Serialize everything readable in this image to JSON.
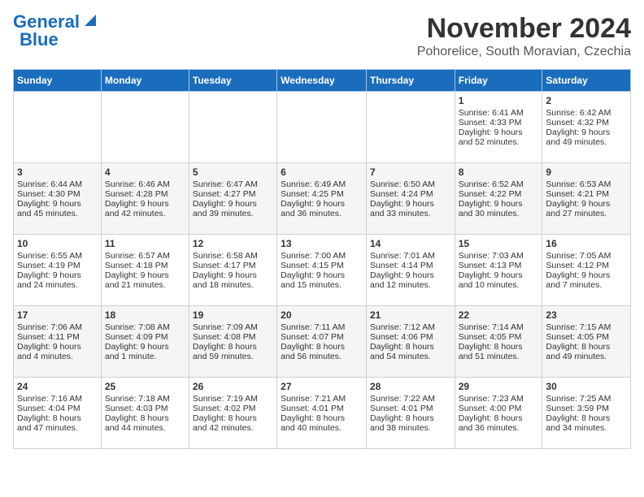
{
  "logo": {
    "line1": "General",
    "line2": "Blue"
  },
  "title": "November 2024",
  "location": "Pohorelice, South Moravian, Czechia",
  "days_header": [
    "Sunday",
    "Monday",
    "Tuesday",
    "Wednesday",
    "Thursday",
    "Friday",
    "Saturday"
  ],
  "weeks": [
    [
      {
        "day": "",
        "data": ""
      },
      {
        "day": "",
        "data": ""
      },
      {
        "day": "",
        "data": ""
      },
      {
        "day": "",
        "data": ""
      },
      {
        "day": "",
        "data": ""
      },
      {
        "day": "1",
        "data": "Sunrise: 6:41 AM\nSunset: 4:33 PM\nDaylight: 9 hours\nand 52 minutes."
      },
      {
        "day": "2",
        "data": "Sunrise: 6:42 AM\nSunset: 4:32 PM\nDaylight: 9 hours\nand 49 minutes."
      }
    ],
    [
      {
        "day": "3",
        "data": "Sunrise: 6:44 AM\nSunset: 4:30 PM\nDaylight: 9 hours\nand 45 minutes."
      },
      {
        "day": "4",
        "data": "Sunrise: 6:46 AM\nSunset: 4:28 PM\nDaylight: 9 hours\nand 42 minutes."
      },
      {
        "day": "5",
        "data": "Sunrise: 6:47 AM\nSunset: 4:27 PM\nDaylight: 9 hours\nand 39 minutes."
      },
      {
        "day": "6",
        "data": "Sunrise: 6:49 AM\nSunset: 4:25 PM\nDaylight: 9 hours\nand 36 minutes."
      },
      {
        "day": "7",
        "data": "Sunrise: 6:50 AM\nSunset: 4:24 PM\nDaylight: 9 hours\nand 33 minutes."
      },
      {
        "day": "8",
        "data": "Sunrise: 6:52 AM\nSunset: 4:22 PM\nDaylight: 9 hours\nand 30 minutes."
      },
      {
        "day": "9",
        "data": "Sunrise: 6:53 AM\nSunset: 4:21 PM\nDaylight: 9 hours\nand 27 minutes."
      }
    ],
    [
      {
        "day": "10",
        "data": "Sunrise: 6:55 AM\nSunset: 4:19 PM\nDaylight: 9 hours\nand 24 minutes."
      },
      {
        "day": "11",
        "data": "Sunrise: 6:57 AM\nSunset: 4:18 PM\nDaylight: 9 hours\nand 21 minutes."
      },
      {
        "day": "12",
        "data": "Sunrise: 6:58 AM\nSunset: 4:17 PM\nDaylight: 9 hours\nand 18 minutes."
      },
      {
        "day": "13",
        "data": "Sunrise: 7:00 AM\nSunset: 4:15 PM\nDaylight: 9 hours\nand 15 minutes."
      },
      {
        "day": "14",
        "data": "Sunrise: 7:01 AM\nSunset: 4:14 PM\nDaylight: 9 hours\nand 12 minutes."
      },
      {
        "day": "15",
        "data": "Sunrise: 7:03 AM\nSunset: 4:13 PM\nDaylight: 9 hours\nand 10 minutes."
      },
      {
        "day": "16",
        "data": "Sunrise: 7:05 AM\nSunset: 4:12 PM\nDaylight: 9 hours\nand 7 minutes."
      }
    ],
    [
      {
        "day": "17",
        "data": "Sunrise: 7:06 AM\nSunset: 4:11 PM\nDaylight: 9 hours\nand 4 minutes."
      },
      {
        "day": "18",
        "data": "Sunrise: 7:08 AM\nSunset: 4:09 PM\nDaylight: 9 hours\nand 1 minute."
      },
      {
        "day": "19",
        "data": "Sunrise: 7:09 AM\nSunset: 4:08 PM\nDaylight: 8 hours\nand 59 minutes."
      },
      {
        "day": "20",
        "data": "Sunrise: 7:11 AM\nSunset: 4:07 PM\nDaylight: 8 hours\nand 56 minutes."
      },
      {
        "day": "21",
        "data": "Sunrise: 7:12 AM\nSunset: 4:06 PM\nDaylight: 8 hours\nand 54 minutes."
      },
      {
        "day": "22",
        "data": "Sunrise: 7:14 AM\nSunset: 4:05 PM\nDaylight: 8 hours\nand 51 minutes."
      },
      {
        "day": "23",
        "data": "Sunrise: 7:15 AM\nSunset: 4:05 PM\nDaylight: 8 hours\nand 49 minutes."
      }
    ],
    [
      {
        "day": "24",
        "data": "Sunrise: 7:16 AM\nSunset: 4:04 PM\nDaylight: 8 hours\nand 47 minutes."
      },
      {
        "day": "25",
        "data": "Sunrise: 7:18 AM\nSunset: 4:03 PM\nDaylight: 8 hours\nand 44 minutes."
      },
      {
        "day": "26",
        "data": "Sunrise: 7:19 AM\nSunset: 4:02 PM\nDaylight: 8 hours\nand 42 minutes."
      },
      {
        "day": "27",
        "data": "Sunrise: 7:21 AM\nSunset: 4:01 PM\nDaylight: 8 hours\nand 40 minutes."
      },
      {
        "day": "28",
        "data": "Sunrise: 7:22 AM\nSunset: 4:01 PM\nDaylight: 8 hours\nand 38 minutes."
      },
      {
        "day": "29",
        "data": "Sunrise: 7:23 AM\nSunset: 4:00 PM\nDaylight: 8 hours\nand 36 minutes."
      },
      {
        "day": "30",
        "data": "Sunrise: 7:25 AM\nSunset: 3:59 PM\nDaylight: 8 hours\nand 34 minutes."
      }
    ]
  ]
}
